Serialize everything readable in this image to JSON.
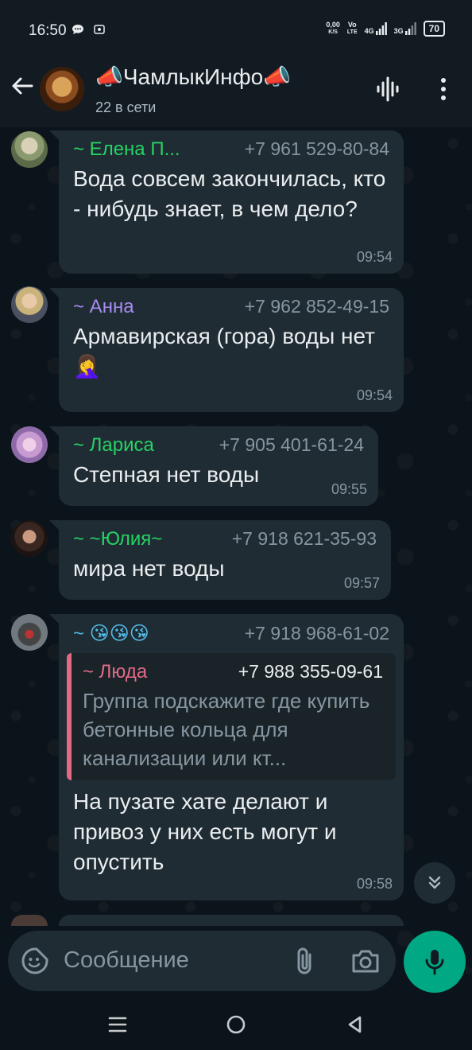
{
  "status_bar": {
    "time": "16:50",
    "net_speed_top": "0,00",
    "net_speed_bottom": "K/S",
    "volte_top": "Vo",
    "volte_bottom": "LTE",
    "sig1_label": "4G",
    "sig2_label": "3G",
    "battery": "70"
  },
  "header": {
    "title": "📣ЧамлыкИнфо📣",
    "subtitle": "22 в сети"
  },
  "messages": [
    {
      "sender": "~ Елена П...",
      "phone": "+7 961 529-80-84",
      "sender_color": "#25d366",
      "text": "Вода совсем закончилась, кто - нибудь знает, в чем дело?",
      "time": "09:54"
    },
    {
      "sender": "~ Анна",
      "phone": "+7 962 852-49-15",
      "sender_color": "#a68bf0",
      "text": "Армавирская (гора) воды нет 🤦‍♀️",
      "time": "09:54"
    },
    {
      "sender": "~ Лариса",
      "phone": "+7 905 401-61-24",
      "sender_color": "#25d366",
      "text": "Степная нет воды",
      "time": "09:55"
    },
    {
      "sender": "~ ~Юлия~",
      "phone": "+7 918 621-35-93",
      "sender_color": "#25d366",
      "text": "мира нет воды",
      "time": "09:57"
    },
    {
      "sender": "~ 😘😘😘",
      "phone": "+7 918 968-61-02",
      "sender_color": "#53bdeb",
      "quote": {
        "sender": "~ Люда",
        "phone": "+7 988 355-09-61",
        "sender_color": "#e26a87",
        "text": "Группа подскажите где купить бетонные кольца для канализации или кт..."
      },
      "text": "На пузате хате делают и привоз у них есть могут и опустить",
      "time": "09:58"
    }
  ],
  "input": {
    "placeholder": "Сообщение"
  },
  "icons": {
    "back": "arrow-left",
    "voice_chat": "audio-wave",
    "menu": "vertical-dots",
    "emoji": "sticker-smile",
    "attach": "paperclip",
    "camera": "camera",
    "mic": "microphone",
    "scroll": "double-chevron-down"
  },
  "colors": {
    "accent": "#00a884",
    "bubble": "#202c33",
    "background": "#0b141a"
  }
}
